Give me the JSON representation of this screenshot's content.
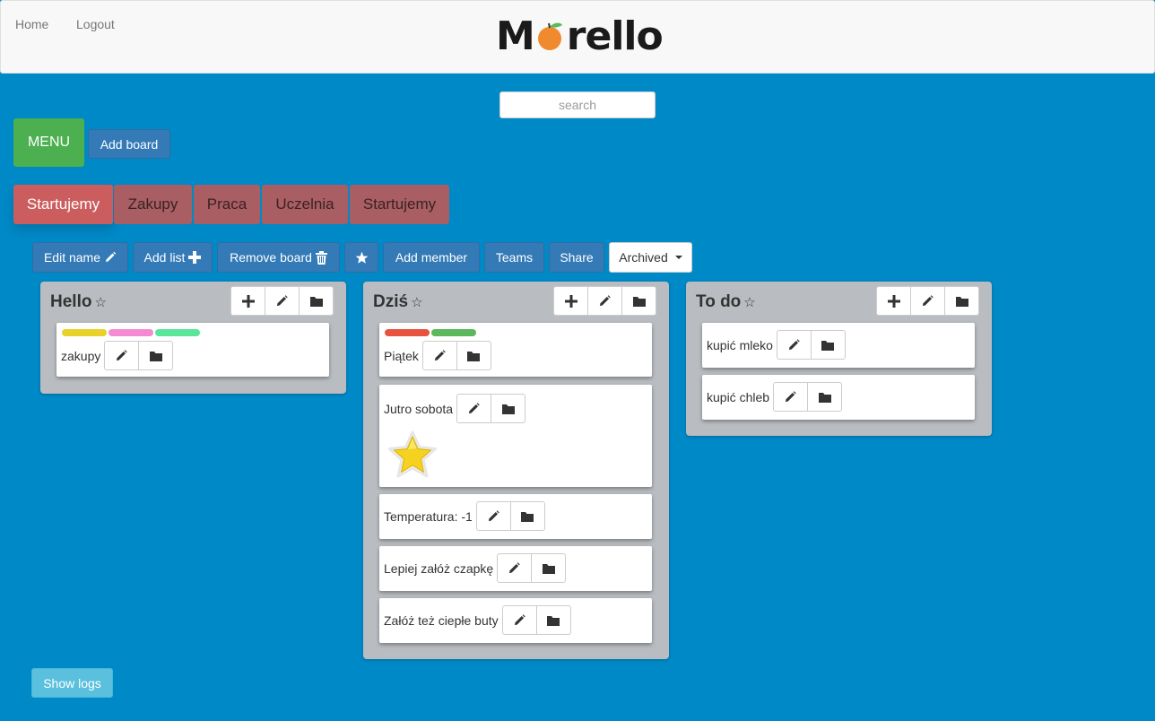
{
  "nav": {
    "home": "Home",
    "logout": "Logout",
    "logo_pre": "M",
    "logo_post": "rello"
  },
  "search": {
    "placeholder": "search"
  },
  "menu_label": "MENU",
  "add_board_label": "Add board",
  "tabs": [
    "Startujemy",
    "Zakupy",
    "Praca",
    "Uczelnia",
    "Startujemy"
  ],
  "toolbar": {
    "edit_name": "Edit name",
    "add_list": "Add list",
    "remove_board": "Remove board",
    "add_member": "Add member",
    "teams": "Teams",
    "share": "Share",
    "archived": "Archived"
  },
  "lists": [
    {
      "title": "Hello",
      "star": "☆",
      "cards": [
        {
          "text": "zakupy",
          "labels": [
            "#e8d22a",
            "#f58ad2",
            "#59e69a"
          ]
        }
      ]
    },
    {
      "title": "Dziś",
      "star": "☆",
      "cards": [
        {
          "text": "Piątek",
          "labels": [
            "#e8533f",
            "#5cb85c"
          ]
        },
        {
          "text": "Jutro sobota",
          "starred": true
        },
        {
          "text": "Temperatura: -1"
        },
        {
          "text": "Lepiej załóż czapkę"
        },
        {
          "text": "Załóż też ciepłe buty"
        }
      ]
    },
    {
      "title": "To do",
      "star": "☆",
      "cards": [
        {
          "text": "kupić mleko"
        },
        {
          "text": "kupić chleb"
        }
      ]
    }
  ],
  "show_logs_label": "Show logs",
  "colors": {
    "background": "#0089c7",
    "primary": "#337ab7",
    "success": "#4caf50",
    "tab": "#a85e62",
    "tab_active": "#cc5d5e",
    "info": "#5bc0de"
  }
}
